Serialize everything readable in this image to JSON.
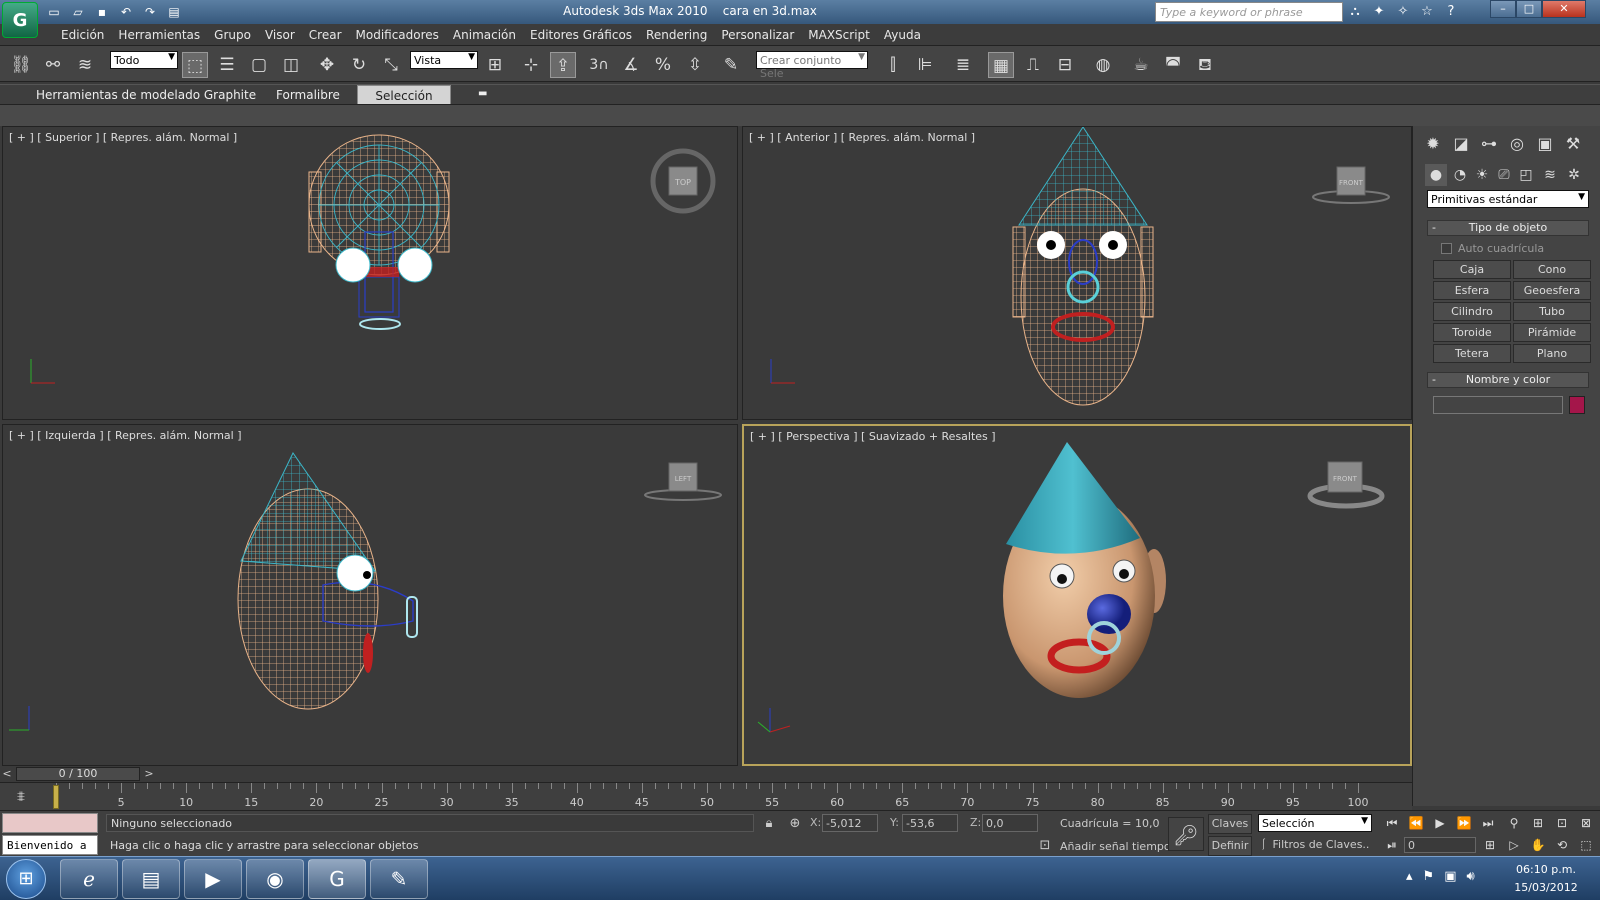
{
  "window": {
    "title": "Autodesk 3ds Max  2010",
    "file": "cara en 3d.max",
    "search_placeholder": "Type a keyword or phrase"
  },
  "menu": [
    "Edición",
    "Herramientas",
    "Grupo",
    "Visor",
    "Crear",
    "Modificadores",
    "Animación",
    "Editores Gráficos",
    "Rendering",
    "Personalizar",
    "MAXScript",
    "Ayuda"
  ],
  "toolbar": {
    "filter_value": "Todo",
    "ref_coord_value": "Vista",
    "named_selection_placeholder": "Crear conjunto Sele",
    "snap_label": "3"
  },
  "ribbon": {
    "tabs": [
      "Herramientas de modelado Graphite",
      "Formalibre",
      "Selección"
    ],
    "active_tab": "Selección"
  },
  "viewports": {
    "top": {
      "label": "[ + ] [ Superior ] [ Repres. alám. Normal ]",
      "cube": "TOP"
    },
    "front": {
      "label": "[ + ] [ Anterior ] [ Repres. alám. Normal ]",
      "cube": "FRONT"
    },
    "left": {
      "label": "[ + ] [ Izquierda ] [ Repres. alám. Normal ]",
      "cube": "LEFT"
    },
    "persp": {
      "label": "[ + ] [ Perspectiva ] [ Suavizado + Resaltes ]",
      "cube": "FRONT"
    }
  },
  "command_panel": {
    "category": "Primitivas estándar",
    "object_type_title": "Tipo de objeto",
    "auto_grid": "Auto cuadrícula",
    "buttons": [
      "Caja",
      "Cono",
      "Esfera",
      "Geoesfera",
      "Cilindro",
      "Tubo",
      "Toroide",
      "Pirámide",
      "Tetera",
      "Plano"
    ],
    "name_color_title": "Nombre y color",
    "color": "#a4164a"
  },
  "timeline": {
    "slider_text": "0 / 100",
    "ticks": [
      "5",
      "10",
      "15",
      "20",
      "25",
      "30",
      "35",
      "40",
      "45",
      "50",
      "55",
      "60",
      "65",
      "70",
      "75",
      "80",
      "85",
      "90",
      "95",
      "100"
    ]
  },
  "status": {
    "welcome": "Bienvenido a",
    "selection": "Ninguno seleccionado",
    "prompt": "Haga clic o haga clic y arrastre para seleccionar objetos",
    "x_label": "X:",
    "x": "-5,012",
    "y_label": "Y:",
    "y": "-53,6",
    "z_label": "Z:",
    "z": "0,0",
    "grid": "Cuadrícula = 10,0",
    "add_time": "Añadir señal tiempo",
    "keys_btn": "Claves",
    "set_btn": "Definir",
    "sel_dropdown": "Selección",
    "filters": "Filtros de Claves..",
    "frame": "0"
  },
  "taskbar": {
    "time": "06:10 p.m.",
    "date": "15/03/2012"
  }
}
